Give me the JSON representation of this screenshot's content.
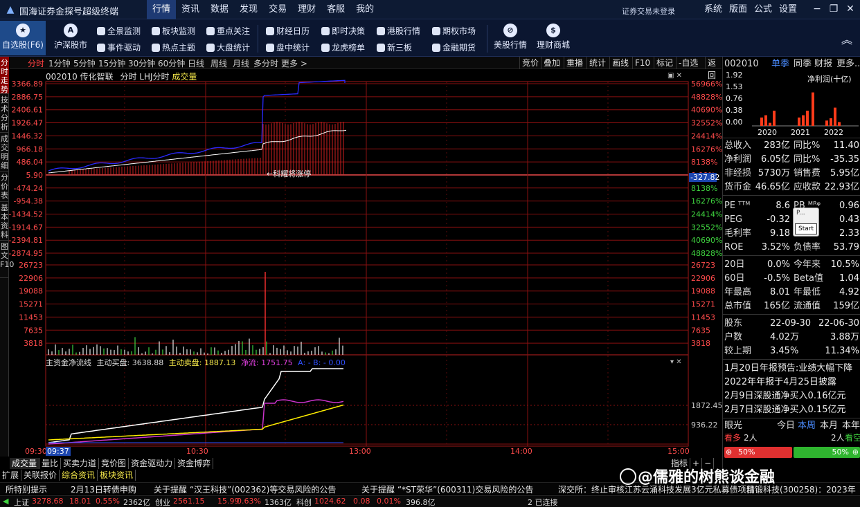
{
  "app": {
    "title": "国海证券金探号超级终端",
    "login_status": "证券交易未登录"
  },
  "main_menu": [
    "行情",
    "资讯",
    "数据",
    "发现",
    "交易",
    "理财",
    "客服",
    "我的"
  ],
  "right_menu": [
    "系统",
    "版面",
    "公式",
    "设置"
  ],
  "window_controls": [
    "−",
    "❐",
    "✕"
  ],
  "toolbar": {
    "big": [
      {
        "label": "自选股(F6)",
        "icon": "star-icon"
      },
      {
        "label": "沪深股市",
        "icon": "a-share-icon"
      },
      {
        "label": "美股行情",
        "icon": "us-stock-icon"
      },
      {
        "label": "理财商城",
        "icon": "money-bag-icon"
      }
    ],
    "small_col1": [
      "全景监测",
      "事件驱动"
    ],
    "small_col2": [
      "板块监测",
      "热点主题"
    ],
    "small_col3": [
      "重点关注",
      "大盘统计"
    ],
    "small_col4": [
      "财经日历",
      "盘中统计"
    ],
    "small_col5": [
      "即时决策",
      "龙虎榜单"
    ],
    "small_col6": [
      "港股行情",
      "新三板"
    ],
    "small_col7": [
      "期权市场",
      "金融期货"
    ]
  },
  "left_tabs": [
    "分时走势",
    "技术分析",
    "成交明细",
    "分价表",
    "基本资料",
    "图文F10"
  ],
  "period_tabs": [
    "分时",
    "1分钟",
    "5分钟",
    "15分钟",
    "30分钟",
    "60分钟",
    "日线",
    "周线",
    "月线",
    "多分时",
    "更多 >"
  ],
  "chart_tools": [
    "竞价",
    "叠加",
    "重播",
    "统计",
    "画线",
    "F10",
    "标记",
    "-自选",
    "返回"
  ],
  "chart_header": {
    "code_name": "002010 传化智联",
    "mode": "分时 LHJ分时",
    "indicator": "成交量"
  },
  "flow_header": {
    "name": "主资金净流线",
    "buy_label": "主动买盘:",
    "buy_value": "3638.88",
    "sell_label": "主动卖盘:",
    "sell_value": "1887.13",
    "net_label": "净流:",
    "net_value": "1751.75",
    "ab": "A: -  B: -  0.00"
  },
  "chart_data": {
    "type": "line",
    "x_ticks": [
      "09:30",
      "09:37",
      "10:30",
      "13:00",
      "14:00",
      "15:00"
    ],
    "price_axis_left": [
      "3366.89",
      "2886.75",
      "2406.61",
      "1926.47",
      "1446.32",
      "966.18",
      "486.04",
      "5.90",
      "-474.24",
      "-954.38",
      "-1434.52",
      "-1914.67",
      "-2394.81",
      "-2874.95"
    ],
    "price_axis_right": [
      "56966%",
      "48828%",
      "40690%",
      "32552%",
      "24414%",
      "16276%",
      "8138%",
      "0.00%",
      "8138%",
      "16276%",
      "24414%",
      "32552%",
      "40690%",
      "48828%"
    ],
    "cursor_value": "-327.82",
    "volume_axis": [
      "26723",
      "22906",
      "19088",
      "15271",
      "11453",
      "7635",
      "3818"
    ],
    "flow_axis": [
      "1872.45",
      "936.22"
    ],
    "annotation": "←科耀将涨停"
  },
  "bottom_tabs": [
    "成交量",
    "量比",
    "买卖力道",
    "竞价图",
    "资金驱动力",
    "资金博弈"
  ],
  "bottom_tabs2": [
    "扩展",
    "关联报价",
    "综合资讯",
    "板块资讯"
  ],
  "time_axis_right": [
    "指标",
    "+",
    "−"
  ],
  "news": [
    "所特别提示",
    "2月13日转债申购",
    "关于提醒 “汉王科技”(002362)等交易风险的公告",
    "关于提醒 “*ST荣华”(600311)交易风险的公告",
    "深交所：终止审核江苏云涌科技发展3亿元私募债项目",
    "精锻科技(300258)：2023年"
  ],
  "status": {
    "sh_name": "上证",
    "sh_price": "3278.68",
    "sh_chg": "18.01",
    "sh_pct": "0.55%",
    "sh_amt": "2362亿",
    "cy_name": "创业",
    "cy_price": "2561.15",
    "cy_chg": "15.99",
    "cy_pct": "0.63%",
    "cy_amt": "1363亿",
    "kc_name": "科创",
    "kc_price": "1024.62",
    "kc_chg": "0.08",
    "kc_pct": "0.01%",
    "kc_amt": "396.8亿",
    "conn": "2 已连接"
  },
  "rpanel": {
    "code": "002010",
    "tabs": [
      "单季",
      "同季",
      "财报",
      "更多.."
    ],
    "mini_chart": {
      "type": "bar",
      "title": "净利润(十亿)",
      "y_ticks": [
        "1.92",
        "1.53",
        "0.76",
        "0.38",
        "0.00"
      ],
      "years": [
        "2020",
        "2021",
        "2022"
      ]
    },
    "fin": [
      {
        "l1": "总收入",
        "v1": "283亿",
        "l2": "同比%",
        "v2": "11.40"
      },
      {
        "l1": "净利润",
        "v1": "6.05亿",
        "l2": "同比%",
        "v2": "-35.35"
      },
      {
        "l1": "非经损",
        "v1": "5730万",
        "l2": "销售费",
        "v2": "5.95亿"
      },
      {
        "l1": "货币金",
        "v1": "46.65亿",
        "l2": "应收款",
        "v2": "22.93亿"
      }
    ],
    "val": [
      {
        "l1": "PE ᵀᵀᴹ",
        "v1": "8.6",
        "l2": "PB ᴹᴿᵠ",
        "v2": "0.96"
      },
      {
        "l1": "PEG",
        "v1": "-0.32",
        "l2": "",
        "v2": "0.43"
      },
      {
        "l1": "毛利率",
        "v1": "9.18",
        "l2": "",
        "v2": "2.33"
      },
      {
        "l1": "ROE",
        "v1": "3.52%",
        "l2": "负债率",
        "v2": "53.79"
      }
    ],
    "perf": [
      {
        "l1": "20日",
        "v1": "0.0%",
        "l2": "今年来",
        "v2": "10.5%"
      },
      {
        "l1": "60日",
        "v1": "-0.5%",
        "l2": "Beta值",
        "v2": "1.04"
      },
      {
        "l1": "年最高",
        "v1": "8.01",
        "l2": "年最低",
        "v2": "4.92"
      },
      {
        "l1": "总市值",
        "v1": "165亿",
        "l2": "流通值",
        "v2": "159亿"
      }
    ],
    "holders": [
      {
        "l1": "股东",
        "v1": "22-09-30",
        "v2": "22-06-30"
      },
      {
        "l1": "户数",
        "v1": "4.02万",
        "v2": "3.88万"
      },
      {
        "l1": "较上期",
        "v1": "3.45%",
        "v2": "11.34%"
      }
    ],
    "news": [
      "1月20日年报预告:业绩大幅下降",
      "2022年年报于4月25日披露",
      "2月9日深股通净买入0.16亿元",
      "2月7日深股通净买入0.15亿元"
    ],
    "yanguang": {
      "title": "眼光",
      "tabs": [
        "今日",
        "本周",
        "本月",
        "本年"
      ],
      "bear": "看多",
      "bear_n": "2人",
      "bull_n": "2人",
      "bull": "看空",
      "left_pct": "50%",
      "right_pct": "50%"
    }
  },
  "popup": {
    "title": "P...",
    "button": "Start"
  },
  "watermark": "@儒雅的树熊谈金融"
}
